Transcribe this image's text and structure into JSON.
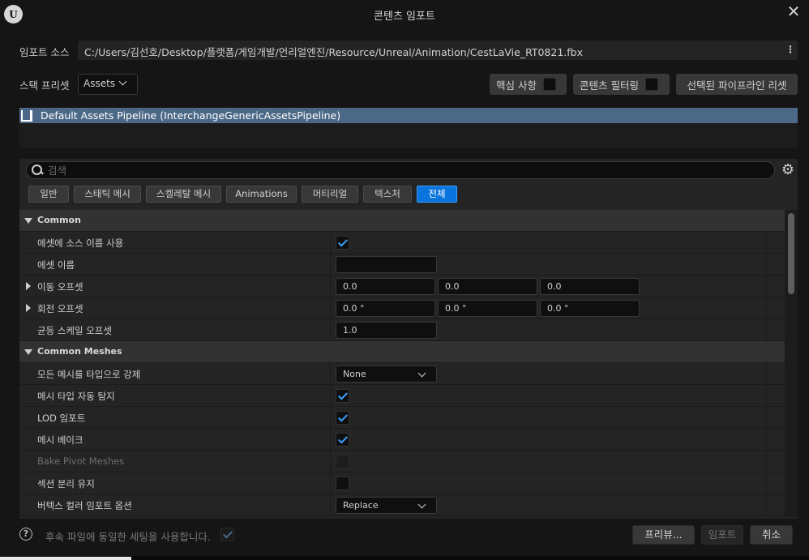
{
  "window": {
    "title": "콘텐츠 임포트",
    "logo_text": "U",
    "close_glyph": "✕"
  },
  "source": {
    "label": "임포트 소스",
    "path": "C:/Users/김선호/Desktop/플랫폼/게임개발/언리얼엔진/Resource/Unreal/Animation/CestLaVie_RT0821.fbx",
    "menu_glyph": "⋮"
  },
  "stack": {
    "label": "스택 프리셋",
    "value": "Assets"
  },
  "top_buttons": {
    "core": "핵심 사항",
    "content_filter": "콘텐츠 필터링",
    "reset_pipeline": "선택된 파이프라인 리셋"
  },
  "pipeline": {
    "label": "Default Assets Pipeline (InterchangeGenericAssetsPipeline)"
  },
  "search": {
    "placeholder": "검색",
    "value": ""
  },
  "icons": {
    "gear": "⚙",
    "help": "?"
  },
  "tabs": [
    {
      "label": "일반",
      "active": false
    },
    {
      "label": "스태틱 메시",
      "active": false
    },
    {
      "label": "스켈레탈 메시",
      "active": false
    },
    {
      "label": "Animations",
      "active": false
    },
    {
      "label": "머티리얼",
      "active": false
    },
    {
      "label": "텍스처",
      "active": false
    },
    {
      "label": "전체",
      "active": true
    }
  ],
  "categories": {
    "common": "Common",
    "common_meshes": "Common Meshes"
  },
  "rows": {
    "use_source_name": {
      "label": "에셋에 소스 이름 사용",
      "checked": true
    },
    "asset_name": {
      "label": "에셋 이름",
      "value": ""
    },
    "translation_offset": {
      "label": "이동 오프셋",
      "x": "0.0",
      "y": "0.0",
      "z": "0.0"
    },
    "rotation_offset": {
      "label": "회전 오프셋",
      "x": "0.0 °",
      "y": "0.0 °",
      "z": "0.0 °"
    },
    "uniform_scale": {
      "label": "균등 스케일 오프셋",
      "value": "1.0"
    },
    "force_mesh_type": {
      "label": "모든 메시를 타입으로 강제",
      "value": "None"
    },
    "auto_detect_mesh_type": {
      "label": "메시 타입 자동 탐지",
      "checked": true
    },
    "import_lods": {
      "label": "LOD 임포트",
      "checked": true
    },
    "bake_meshes": {
      "label": "메시 베이크",
      "checked": true
    },
    "bake_pivot_meshes": {
      "label": "Bake Pivot Meshes",
      "checked": false,
      "disabled": true
    },
    "keep_sections_separate": {
      "label": "섹션 분리 유지",
      "checked": false
    },
    "vertex_color_import": {
      "label": "버텍스 컬러 임포트 옵션",
      "value": "Replace"
    }
  },
  "footer": {
    "use_same_settings_label": "후속 파일에 동일한 세팅을 사용합니다.",
    "preview": "프리뷰...",
    "import": "임포트",
    "cancel": "취소"
  },
  "colors": {
    "accent": "#0a74de",
    "pipeline_selected": "#4b6987",
    "check": "#3ba0ff"
  }
}
